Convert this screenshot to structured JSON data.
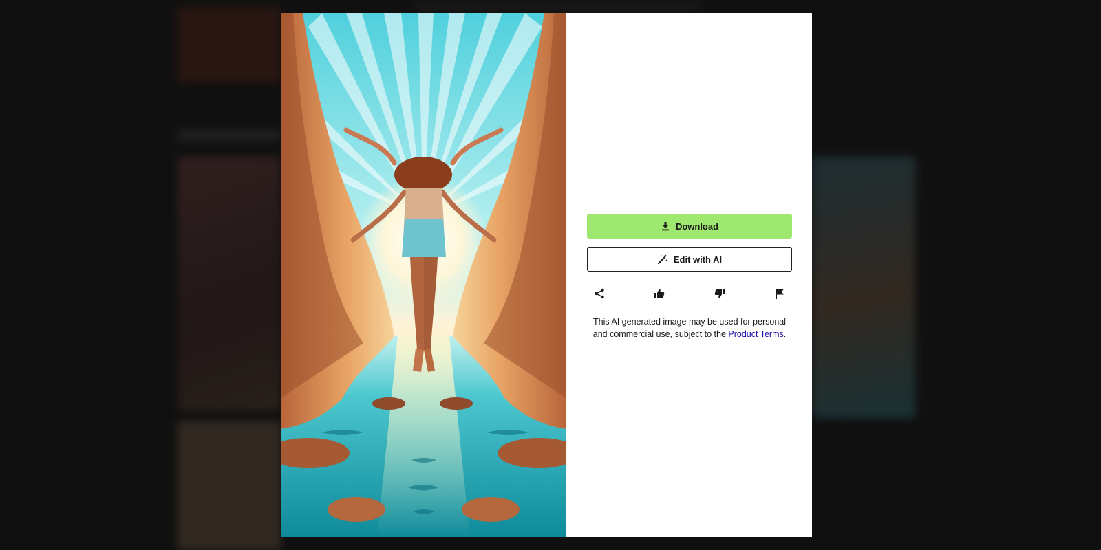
{
  "modal": {
    "download_label": "Download",
    "edit_label": "Edit with AI",
    "actions": {
      "share_icon": "share-icon",
      "like_icon": "thumbs-up-icon",
      "dislike_icon": "thumbs-down-icon",
      "report_icon": "flag-icon"
    },
    "notice": {
      "text_before": "This AI generated image may be used for personal and commercial use, subject to the ",
      "link_text": "Product Terms",
      "text_after": "."
    },
    "colors": {
      "download_bg": "#9fe870",
      "link": "#1a0dab"
    }
  }
}
